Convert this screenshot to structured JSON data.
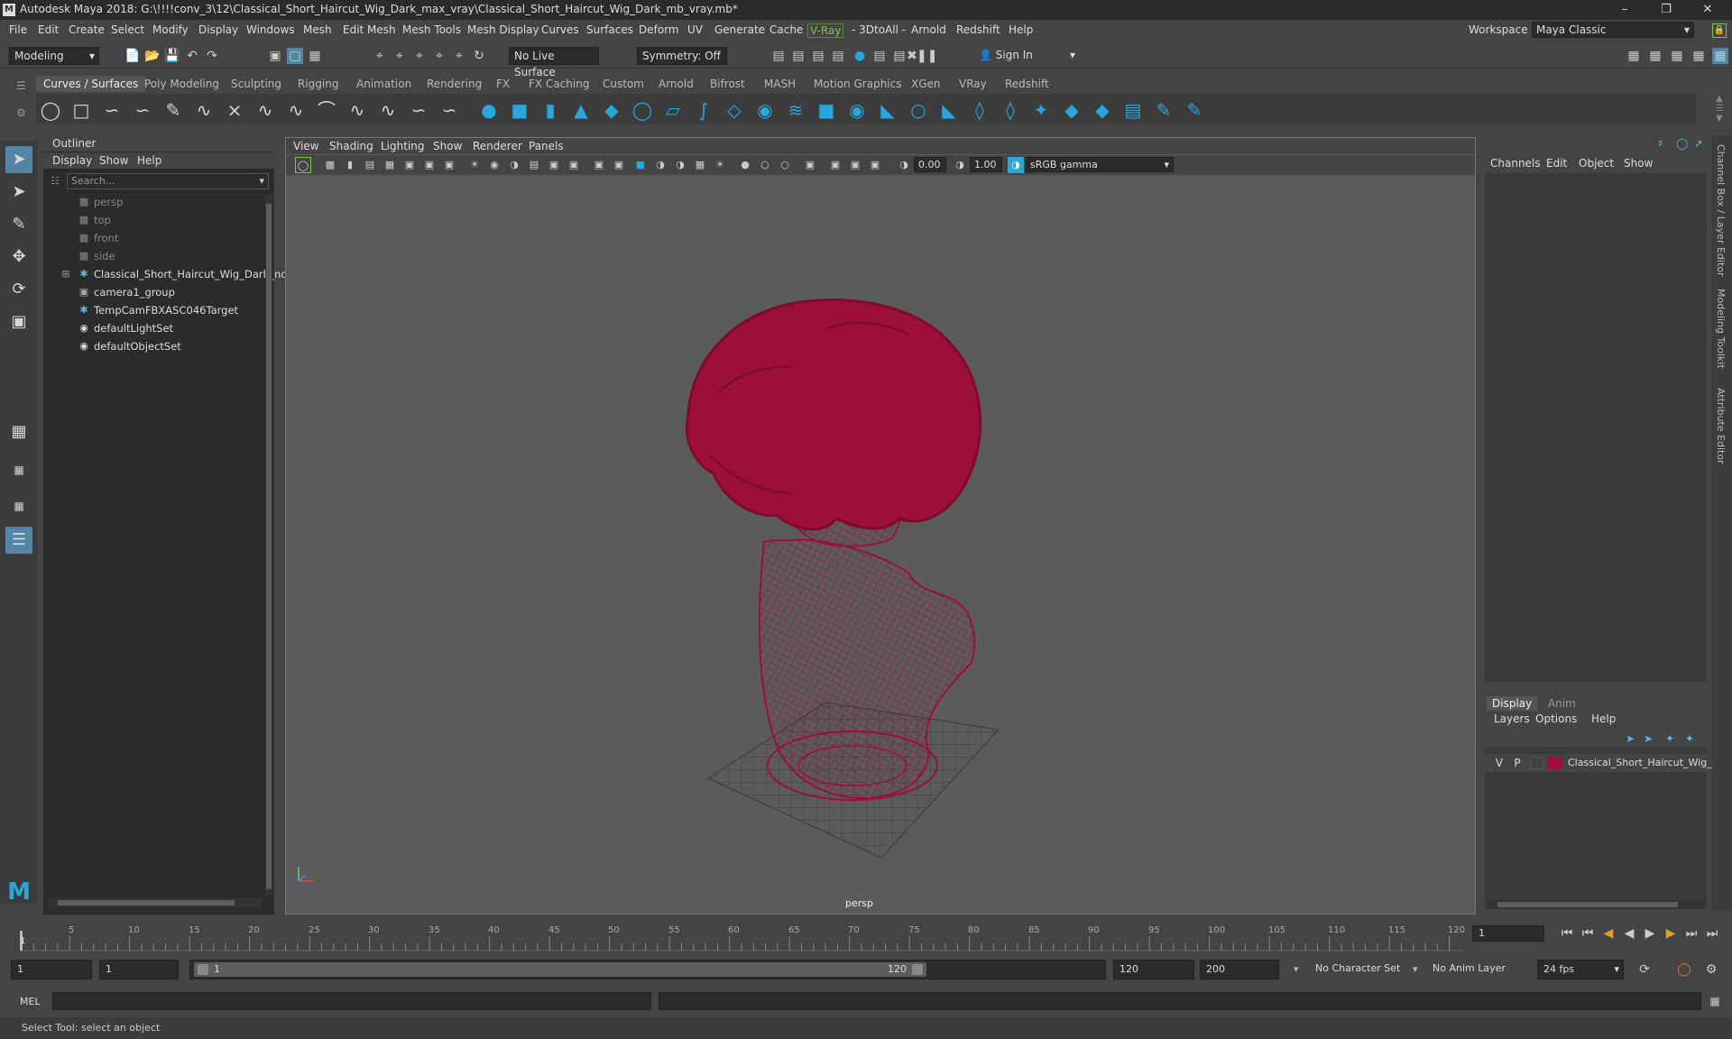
{
  "window": {
    "title": "Autodesk Maya 2018: G:\\!!!!conv_3\\12\\Classical_Short_Haircut_Wig_Dark_max_vray\\Classical_Short_Haircut_Wig_Dark_mb_vray.mb*"
  },
  "menubar": {
    "items": [
      "File",
      "Edit",
      "Create",
      "Select",
      "Modify",
      "Display",
      "Windows",
      "Mesh",
      "Edit Mesh",
      "Mesh Tools",
      "Mesh Display",
      "Curves",
      "Surfaces",
      "Deform",
      "UV",
      "Generate",
      "Cache",
      "V-Ray",
      "- 3DtoAll -",
      "Arnold",
      "Redshift",
      "Help"
    ]
  },
  "workspace": {
    "label": "Workspace :",
    "value": "Maya Classic"
  },
  "statusline": {
    "mode": "Modeling",
    "live_surface": "No Live Surface",
    "symmetry": "Symmetry: Off",
    "sign_in": "Sign In"
  },
  "shelf": {
    "tabs": [
      "Curves / Surfaces",
      "Poly Modeling",
      "Sculpting",
      "Rigging",
      "Animation",
      "Rendering",
      "FX",
      "FX Caching",
      "Custom",
      "Arnold",
      "Bifrost",
      "MASH",
      "Motion Graphics",
      "XGen",
      "VRay",
      "Redshift"
    ],
    "active": "Curves / Surfaces"
  },
  "outliner": {
    "title": "Outliner",
    "menu": [
      "Display",
      "Show",
      "Help"
    ],
    "search_placeholder": "Search...",
    "items": [
      {
        "label": "persp",
        "dim": true
      },
      {
        "label": "top",
        "dim": true
      },
      {
        "label": "front",
        "dim": true
      },
      {
        "label": "side",
        "dim": true
      },
      {
        "label": "Classical_Short_Haircut_Wig_Dark_nc",
        "dim": false
      },
      {
        "label": "camera1_group",
        "dim": false
      },
      {
        "label": "TempCamFBXASC046Target",
        "dim": false
      },
      {
        "label": "defaultLightSet",
        "dim": false
      },
      {
        "label": "defaultObjectSet",
        "dim": false
      }
    ]
  },
  "viewport": {
    "menu": [
      "View",
      "Shading",
      "Lighting",
      "Show",
      "Renderer",
      "Panels"
    ],
    "exposure": "0.00",
    "gamma": "1.00",
    "color_space": "sRGB gamma",
    "camera": "persp",
    "mesh_color": "#9b0f3a"
  },
  "channelbox": {
    "menu": [
      "Channels",
      "Edit",
      "Object",
      "Show"
    ]
  },
  "layer_editor": {
    "tabs": [
      "Display",
      "Anim"
    ],
    "menu": [
      "Layers",
      "Options",
      "Help"
    ],
    "layer": {
      "v": "V",
      "p": "P",
      "name": "Classical_Short_Haircut_Wig_D",
      "color": "#9b0f3a"
    }
  },
  "side_tabs": [
    "Channel Box / Layer Editor",
    "Modeling Toolkit",
    "Attribute Editor"
  ],
  "timeline": {
    "ticks": [
      "5",
      "10",
      "15",
      "20",
      "25",
      "30",
      "35",
      "40",
      "45",
      "50",
      "55",
      "60",
      "65",
      "70",
      "75",
      "80",
      "85",
      "90",
      "95",
      "100",
      "105",
      "110",
      "115",
      "120"
    ],
    "current_frame": "1",
    "start_field": "1"
  },
  "range": {
    "start": "1",
    "playback_start": "1",
    "slider_start": "1",
    "slider_end": "120",
    "playback_end": "120",
    "end": "200",
    "character_set": "No Character Set",
    "anim_layer": "No Anim Layer",
    "fps": "24 fps"
  },
  "command": {
    "lang": "MEL"
  },
  "help_line": "Select Tool: select an object"
}
